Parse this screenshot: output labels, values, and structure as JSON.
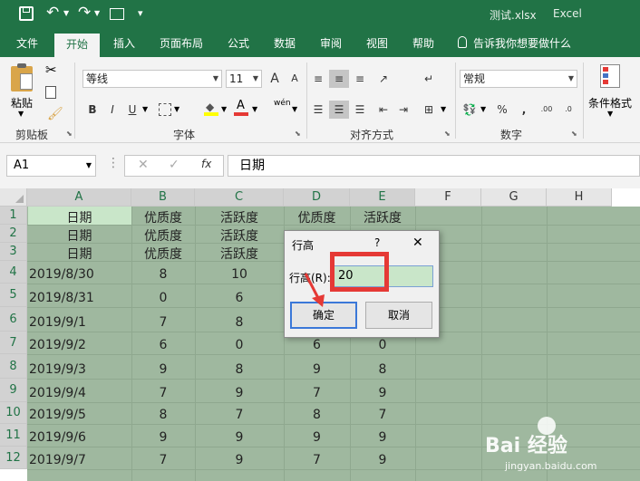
{
  "window": {
    "filename": "测试.xlsx",
    "app": "Excel"
  },
  "tabs": [
    "文件",
    "开始",
    "插入",
    "页面布局",
    "公式",
    "数据",
    "审阅",
    "视图",
    "帮助"
  ],
  "tell_me": "告诉我你想要做什么",
  "ribbon": {
    "clipboard": {
      "paste": "粘贴",
      "label": "剪贴板"
    },
    "font": {
      "name": "等线",
      "size": "11",
      "label": "字体",
      "bold": "B",
      "italic": "I",
      "underline": "U",
      "phonetic": "wén",
      "font_color": "A",
      "grow": "A",
      "shrink": "A"
    },
    "alignment": {
      "label": "对齐方式"
    },
    "number": {
      "format": "常规",
      "label": "数字",
      "percent": "%",
      "comma": ","
    },
    "styles": {
      "label": "条件格式"
    }
  },
  "formula_bar": {
    "name_box": "A1",
    "fx": "fx",
    "value": "日期"
  },
  "columns": [
    "A",
    "B",
    "C",
    "D",
    "E",
    "F",
    "G",
    "H"
  ],
  "rows": [
    "1",
    "2",
    "3",
    "4",
    "5",
    "6",
    "7",
    "8",
    "9",
    "10",
    "11",
    "12"
  ],
  "headers": [
    [
      "日期",
      "优质度",
      "活跃度",
      "优质度",
      "活跃度"
    ],
    [
      "日期",
      "优质度",
      "活跃度",
      "",
      ""
    ],
    [
      "日期",
      "优质度",
      "活跃度",
      "",
      ""
    ]
  ],
  "data_rows": [
    [
      "2019/8/30",
      "8",
      "10",
      "",
      ""
    ],
    [
      "2019/8/31",
      "0",
      "6",
      "",
      ""
    ],
    [
      "2019/9/1",
      "7",
      "8",
      "",
      ""
    ],
    [
      "2019/9/2",
      "6",
      "0",
      "6",
      "0"
    ],
    [
      "2019/9/3",
      "9",
      "8",
      "9",
      "8"
    ],
    [
      "2019/9/4",
      "7",
      "9",
      "7",
      "9"
    ],
    [
      "2019/9/5",
      "8",
      "7",
      "8",
      "7"
    ],
    [
      "2019/9/6",
      "9",
      "9",
      "9",
      "9"
    ],
    [
      "2019/9/7",
      "7",
      "9",
      "7",
      "9"
    ]
  ],
  "dialog": {
    "title": "行高",
    "help": "?",
    "close": "✕",
    "label": "行高(R):",
    "value": "20",
    "ok": "确定",
    "cancel": "取消"
  },
  "watermark": {
    "brand": "Bai 经验",
    "url": "jingyan.baidu.com"
  },
  "colors": {
    "excel_green": "#217346",
    "selection": "#9fb89f",
    "highlight": "#e53935"
  }
}
